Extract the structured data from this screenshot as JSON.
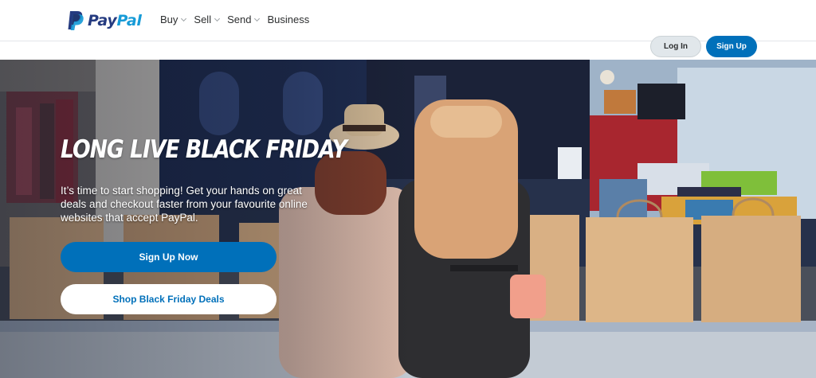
{
  "brand": {
    "name_part1": "Pay",
    "name_part2": "Pal",
    "colors": {
      "dark_blue": "#253b80",
      "light_blue": "#179bd7",
      "accent": "#0070ba"
    }
  },
  "nav": {
    "items": [
      {
        "label": "Buy",
        "has_dropdown": true
      },
      {
        "label": "Sell",
        "has_dropdown": true
      },
      {
        "label": "Send",
        "has_dropdown": true
      },
      {
        "label": "Business",
        "has_dropdown": false
      }
    ]
  },
  "auth": {
    "login_label": "Log In",
    "signup_label": "Sign Up"
  },
  "hero": {
    "title": "LONG LIVE BLACK FRIDAY",
    "text": "It’s time to start shopping! Get your hands on great deals and checkout faster from your favourite online websites that accept PayPal.",
    "primary_button": "Sign Up Now",
    "secondary_button": "Shop Black Friday Deals"
  },
  "icons": [
    "paypal-logo-icon",
    "chevron-down-icon"
  ]
}
